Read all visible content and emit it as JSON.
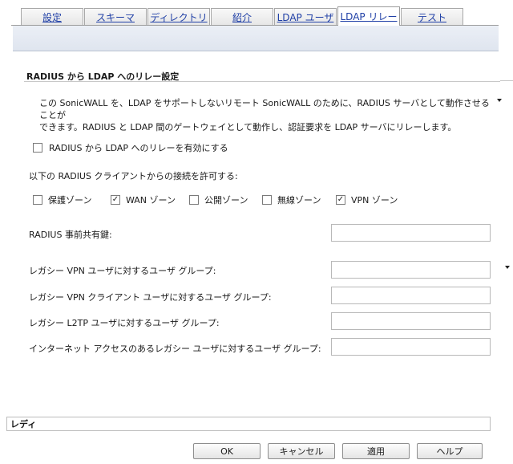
{
  "tabs": [
    {
      "label": "設定"
    },
    {
      "label": "スキーマ"
    },
    {
      "label": "ディレクトリ"
    },
    {
      "label": "紹介"
    },
    {
      "label": "LDAP ユーザ"
    },
    {
      "label": "LDAP リレー"
    },
    {
      "label": "テスト"
    }
  ],
  "active_tab": "LDAP リレー",
  "section": {
    "title": "RADIUS から LDAP へのリレー設定",
    "description_line1": "この SonicWALL を、LDAP をサポートしないリモート SonicWALL のために、RADIUS サーバとして動作させることが",
    "description_line2": "できます。RADIUS と LDAP 間のゲートウェイとして動作し、認証要求を LDAP サーバにリレーします。"
  },
  "enable_relay": {
    "label": "RADIUS から LDAP へのリレーを有効にする",
    "checked": false
  },
  "allowed_clients": {
    "label": "以下の RADIUS クライアントからの接続を許可する:",
    "zones": [
      {
        "label": "保護ゾーン",
        "checked": false
      },
      {
        "label": "WAN ゾーン",
        "checked": true
      },
      {
        "label": "公開ゾーン",
        "checked": false
      },
      {
        "label": "無線ゾーン",
        "checked": false
      },
      {
        "label": "VPN ゾーン",
        "checked": true
      }
    ]
  },
  "fields": {
    "shared_secret": {
      "label": "RADIUS 事前共有鍵:",
      "value": ""
    },
    "legacy_vpn_users": {
      "label": "レガシー VPN ユーザに対するユーザ グループ:",
      "value": ""
    },
    "legacy_vpn_clients": {
      "label": "レガシー VPN クライアント ユーザに対するユーザ グループ:",
      "value": ""
    },
    "legacy_l2tp_users": {
      "label": "レガシー L2TP ユーザに対するユーザ グループ:",
      "value": ""
    },
    "legacy_internet_users": {
      "label": "インターネット アクセスのあるレガシー ユーザに対するユーザ グループ:",
      "value": ""
    }
  },
  "status": {
    "text": "レディ"
  },
  "buttons": {
    "ok": "OK",
    "cancel": "キャンセル",
    "apply": "適用",
    "help": "ヘルプ"
  },
  "icons": {
    "checked": "checkmark-icon",
    "marker": "triangle-down-icon"
  }
}
